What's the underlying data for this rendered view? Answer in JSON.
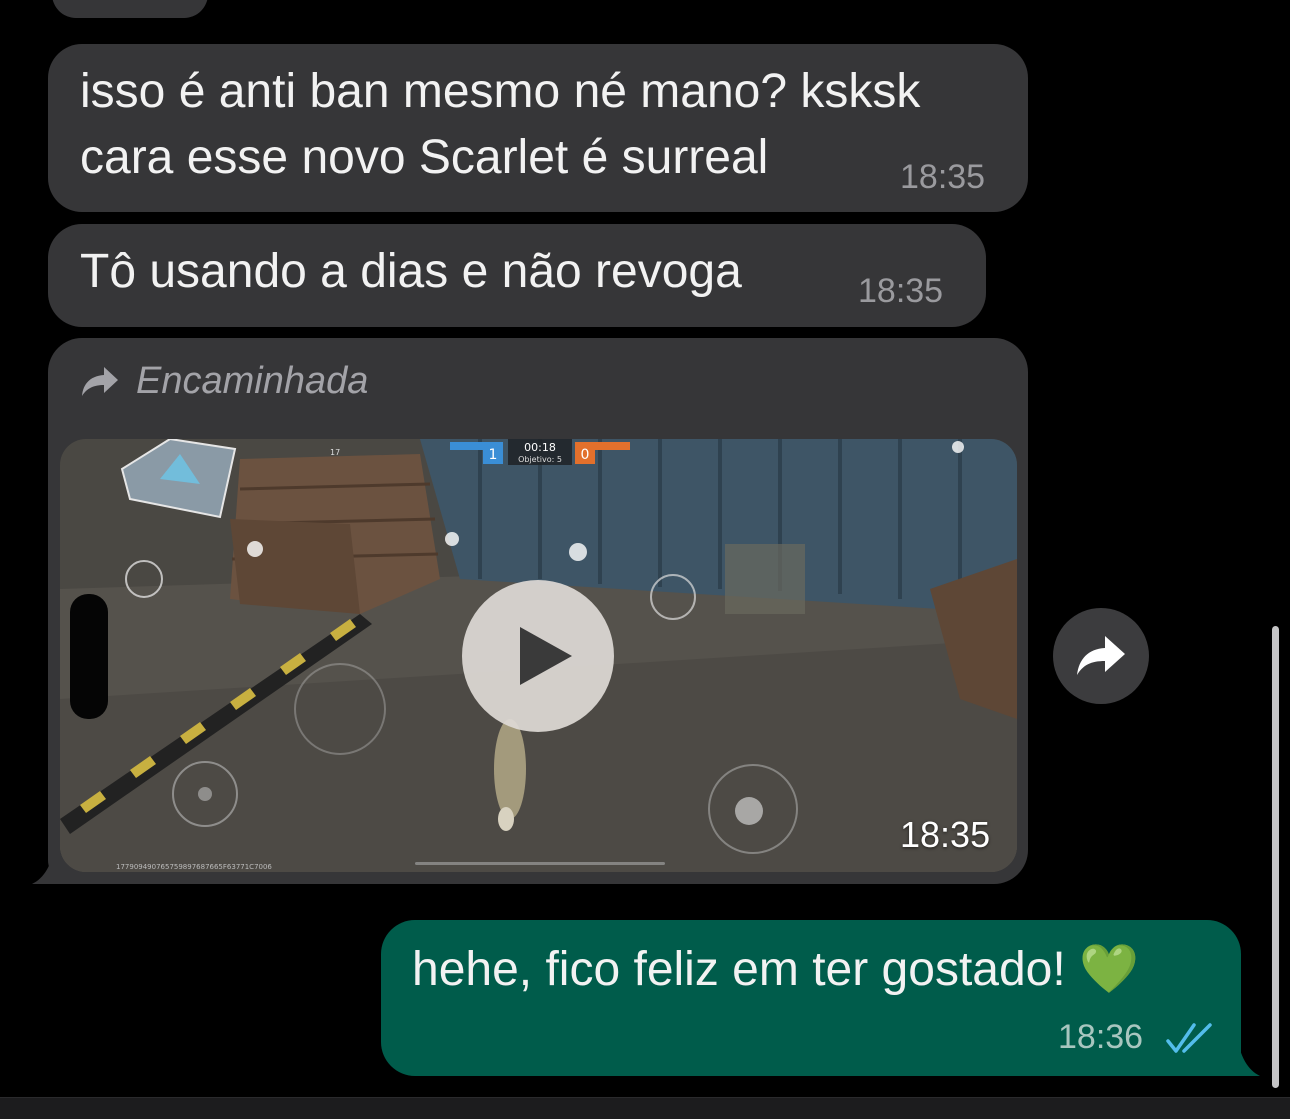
{
  "messages": [
    {
      "lines": [
        "isso é anti ban mesmo né mano? ksksk",
        "cara esse novo Scarlet é surreal"
      ],
      "time": "18:35"
    },
    {
      "lines": [
        "Tô usando a dias e não revoga"
      ],
      "time": "18:35"
    },
    {
      "forwarded_label": "Encaminhada",
      "video_time": "18:35",
      "video_hud": {
        "timer": "00:18",
        "objective": "Objetivo: 5",
        "team_blue_score": "1",
        "team_orange_score": "0",
        "wifi_level": "17",
        "player_id": "177909490765759897687665F63771C7006"
      }
    },
    {
      "text": "hehe, fico feliz em ter gostado! 💚",
      "time": "18:36"
    }
  ],
  "icons": {
    "forward": "forward-arrow-icon",
    "play": "play-icon",
    "share": "share-forward-icon",
    "read_receipt": "double-check-icon",
    "heart": "green-heart-emoji"
  },
  "colors": {
    "background": "#000000",
    "incoming_bubble": "#363638",
    "outgoing_bubble": "#005c4b",
    "read_ticks": "#53bdeb",
    "heart": "#2ed52e"
  }
}
